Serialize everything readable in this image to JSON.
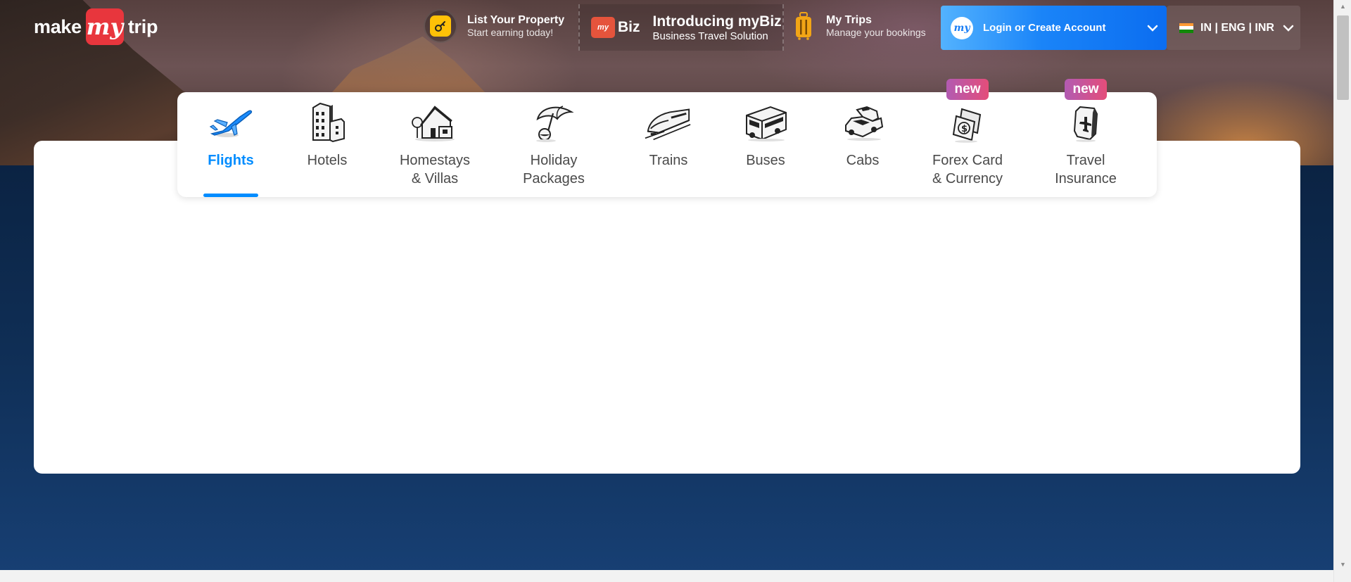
{
  "brand": {
    "logo_part1": "make",
    "logo_badge": "my",
    "logo_part2": "trip"
  },
  "header": {
    "list_property": {
      "title": "List Your Property",
      "subtitle": "Start earning today!",
      "icon": "key-house-icon"
    },
    "mybiz": {
      "logo_text": "Biz",
      "logo_badge": "my",
      "title": "Introducing myBiz",
      "subtitle": "Business Travel Solution",
      "icon": "mybiz-bag-icon"
    },
    "my_trips": {
      "title": "My Trips",
      "subtitle": "Manage your bookings",
      "icon": "suitcase-icon"
    },
    "login": {
      "avatar_text": "my",
      "label": "Login or Create Account",
      "icon": "chevron-down-icon"
    },
    "locale": {
      "label": "IN | ENG | INR",
      "flag": "india-flag-icon",
      "icon": "chevron-down-icon"
    }
  },
  "nav": {
    "items": [
      {
        "label": "Flights",
        "icon": "airplane-icon",
        "active": true,
        "badge": ""
      },
      {
        "label": "Hotels",
        "icon": "hotel-building-icon",
        "active": false,
        "badge": ""
      },
      {
        "label": "Homestays\n& Villas",
        "icon": "homestay-house-icon",
        "active": false,
        "badge": ""
      },
      {
        "label": "Holiday\nPackages",
        "icon": "beach-umbrella-icon",
        "active": false,
        "badge": ""
      },
      {
        "label": "Trains",
        "icon": "train-icon",
        "active": false,
        "badge": ""
      },
      {
        "label": "Buses",
        "icon": "bus-icon",
        "active": false,
        "badge": ""
      },
      {
        "label": "Cabs",
        "icon": "cab-icon",
        "active": false,
        "badge": ""
      },
      {
        "label": "Forex Card\n& Currency",
        "icon": "forex-card-icon",
        "active": false,
        "badge": "new"
      },
      {
        "label": "Travel\nInsurance",
        "icon": "insurance-shield-icon",
        "active": false,
        "badge": "new"
      }
    ]
  },
  "colors": {
    "accent": "#008cff",
    "brand_red": "#e8363d",
    "login_gradient_start": "#53b2fe",
    "login_gradient_end": "#0b6df0",
    "badge_gradient_start": "#b25bb2",
    "badge_gradient_end": "#e44d7a",
    "key_yellow": "#ffc107"
  }
}
